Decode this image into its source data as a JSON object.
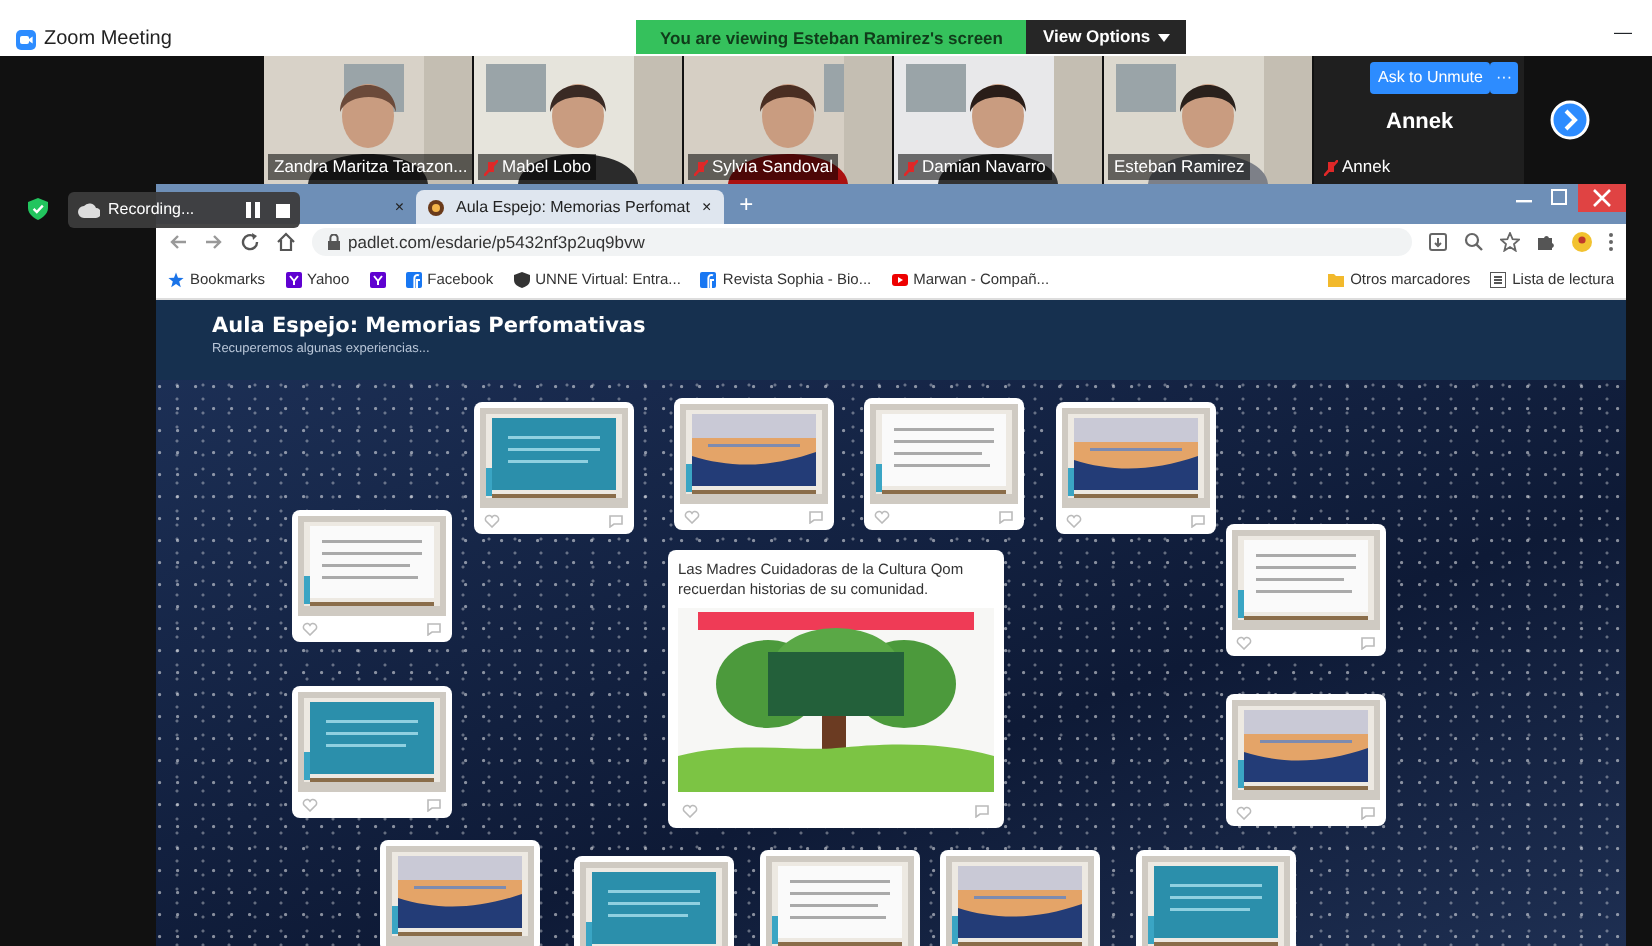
{
  "window": {
    "title": "Zoom Meeting",
    "minimize": "—"
  },
  "share_banner": {
    "text": "You are viewing Esteban Ramirez's screen",
    "options": "View Options"
  },
  "participants": [
    {
      "name": "Zandra Maritza Tarazon...",
      "muted": false
    },
    {
      "name": "Mabel Lobo",
      "muted": true
    },
    {
      "name": "Sylvia Sandoval",
      "muted": true
    },
    {
      "name": "Damian Navarro",
      "muted": true
    },
    {
      "name": "Esteban Ramirez",
      "muted": false
    }
  ],
  "self_tile": {
    "unmute_button": "Ask to Unmute",
    "more_button": "···",
    "name": "Annek",
    "label": "Annek",
    "muted": true
  },
  "recording": {
    "label": "Recording..."
  },
  "browser": {
    "tabs": [
      {
        "close": "×",
        "selected": false
      },
      {
        "title": "Aula Espejo: Memorias Perfomat",
        "close": "×",
        "selected": true
      }
    ],
    "new_tab": "+",
    "url": "padlet.com/esdarie/p5432nf3p2uq9bvw",
    "bookmarks": [
      {
        "kind": "star",
        "label": "Bookmarks"
      },
      {
        "kind": "yahoo",
        "label": "Yahoo"
      },
      {
        "kind": "yahoo"
      },
      {
        "kind": "facebook",
        "label": "Facebook"
      },
      {
        "kind": "shield",
        "label": "UNNE Virtual: Entra..."
      },
      {
        "kind": "facebook",
        "label": "Revista Sophia - Bio..."
      },
      {
        "kind": "youtube",
        "label": "Marwan - Compañ..."
      }
    ],
    "bookmarks_right": [
      {
        "kind": "folder",
        "label": "Otros marcadores"
      },
      {
        "kind": "list",
        "label": "Lista de lectura"
      }
    ]
  },
  "padlet": {
    "title": "Aula Espejo: Memorias Perfomativas",
    "subtitle": "Recuperemos algunas experiencias...",
    "featured_post": {
      "text": "Las Madres Cuidadoras de la Cultura Qom recuerdan historias de su comunidad.",
      "kind": "picture"
    }
  }
}
